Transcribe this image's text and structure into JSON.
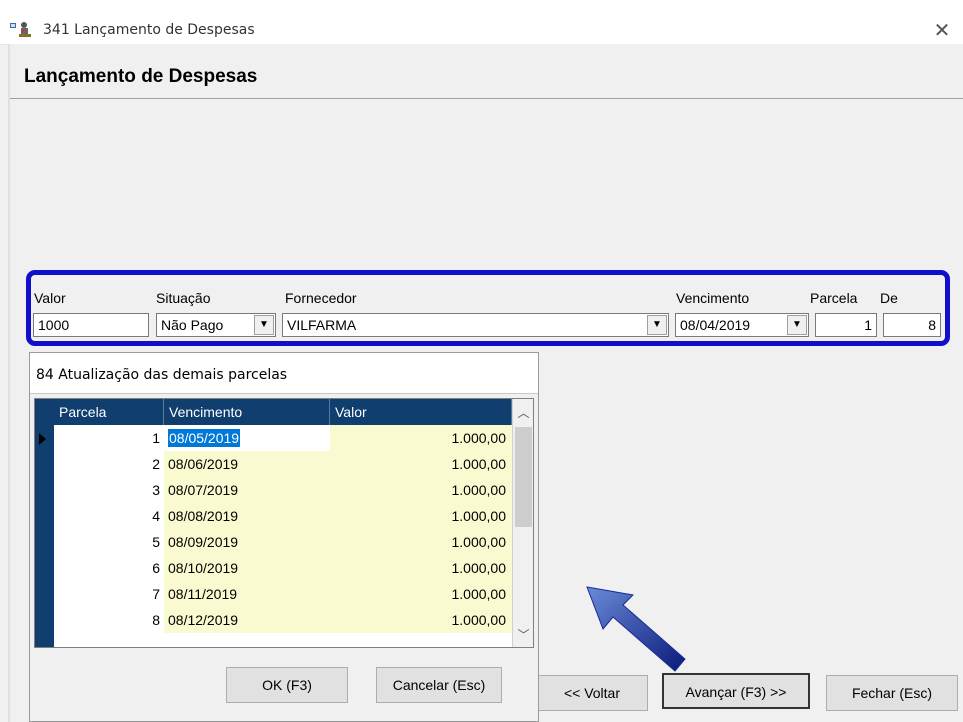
{
  "window": {
    "title": "341 Lançamento de Despesas",
    "close_glyph": "✕",
    "heading": "Lançamento de Despesas"
  },
  "form": {
    "valor_label": "Valor",
    "valor_value": "1000",
    "situacao_label": "Situação",
    "situacao_value": "Não Pago",
    "fornecedor_label": "Fornecedor",
    "fornecedor_value": "VILFARMA",
    "vencimento_label": "Vencimento",
    "vencimento_value": "08/04/2019",
    "parcela_label": "Parcela",
    "parcela_value": "1",
    "de_label": "De",
    "de_value": "8",
    "highlight_color": "#1010cc"
  },
  "popup": {
    "title": "84 Atualização das demais parcelas",
    "columns": [
      "Parcela",
      "Vencimento",
      "Valor"
    ],
    "rows": [
      {
        "parcela": "1",
        "vencimento": "08/05/2019",
        "valor": "1.000,00"
      },
      {
        "parcela": "2",
        "vencimento": "08/06/2019",
        "valor": "1.000,00"
      },
      {
        "parcela": "3",
        "vencimento": "08/07/2019",
        "valor": "1.000,00"
      },
      {
        "parcela": "4",
        "vencimento": "08/08/2019",
        "valor": "1.000,00"
      },
      {
        "parcela": "5",
        "vencimento": "08/09/2019",
        "valor": "1.000,00"
      },
      {
        "parcela": "6",
        "vencimento": "08/10/2019",
        "valor": "1.000,00"
      },
      {
        "parcela": "7",
        "vencimento": "08/11/2019",
        "valor": "1.000,00"
      },
      {
        "parcela": "8",
        "vencimento": "08/12/2019",
        "valor": "1.000,00"
      }
    ],
    "ok_label": "OK (F3)",
    "cancel_label": "Cancelar (Esc)",
    "header_color": "#0f3e6f",
    "cell_color": "#fafad0"
  },
  "footer": {
    "voltar_label": "<< Voltar",
    "avancar_label": "Avançar (F3) >>",
    "fechar_label": "Fechar (Esc)"
  },
  "annotation": {
    "arrow_color": "#1a2a9a"
  }
}
